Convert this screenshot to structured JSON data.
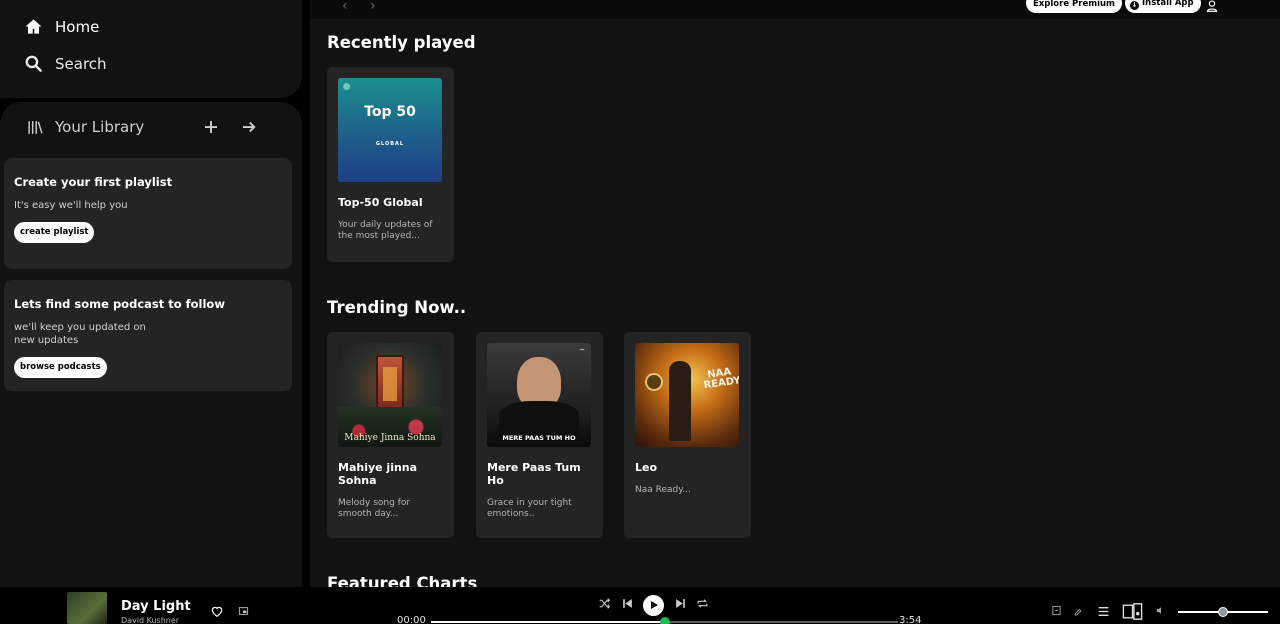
{
  "sidebar": {
    "nav": {
      "home": "Home",
      "search": "Search"
    },
    "library": {
      "label": "Your Library"
    },
    "promos": [
      {
        "title": "Create your first playlist",
        "text": "It's easy we'll help you",
        "button": "create playlist"
      },
      {
        "title": "Lets find some podcast to follow",
        "text": "we'll keep you updated on new updates",
        "button": "browse podcasts"
      }
    ]
  },
  "topbar": {
    "explore": "Explore Premium",
    "install": "Install App"
  },
  "sections": {
    "recent": {
      "title": "Recently played",
      "items": [
        {
          "title": "Top-50 Global",
          "subtitle": "Your daily updates of the most played...",
          "art_big": "Top 50",
          "art_small": "GLOBAL"
        }
      ]
    },
    "trending": {
      "title": "Trending Now..",
      "items": [
        {
          "title": "Mahiye jinna Sohna",
          "subtitle": "Melody song for smooth day...",
          "art_text": "Mahiye Jinna Sohna"
        },
        {
          "title": "Mere Paas Tum Ho",
          "subtitle": "Grace in your tight emotions..",
          "art_text": "MERE PAAS TUM HO"
        },
        {
          "title": "Leo",
          "subtitle": "Naa Ready...",
          "art_text": "NAA READY"
        }
      ]
    },
    "featured": {
      "title": "Featured Charts"
    }
  },
  "player": {
    "title": "Day Light",
    "artist": "David Kushner",
    "current_time": "00:00",
    "total_time": "3:54",
    "progress": 0.5,
    "volume": 0.5,
    "accent": "#1db954"
  }
}
